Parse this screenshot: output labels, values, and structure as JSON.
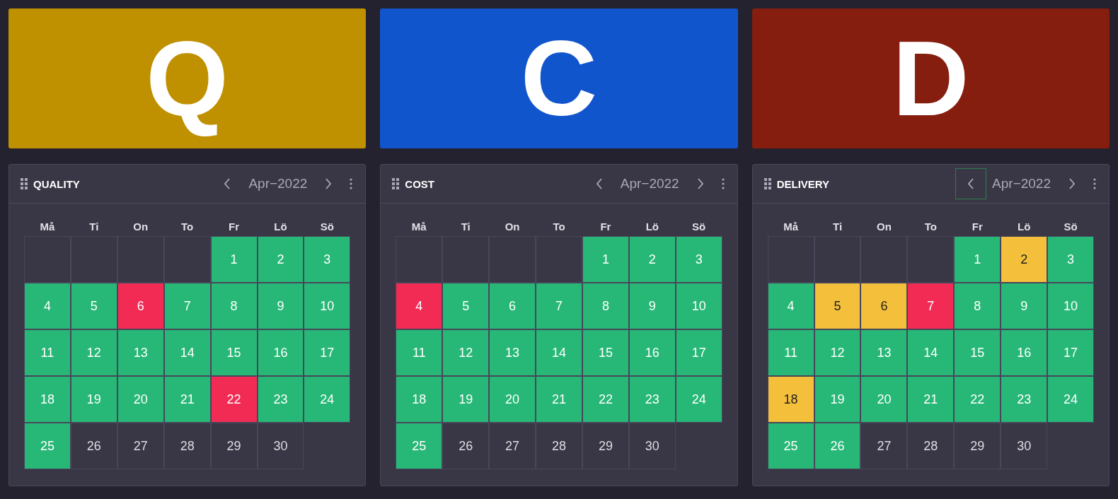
{
  "tiles": [
    {
      "letter": "Q",
      "color": "#bf9000"
    },
    {
      "letter": "C",
      "color": "#1155cc"
    },
    {
      "letter": "D",
      "color": "#851e0e"
    }
  ],
  "panels": [
    {
      "title": "QUALITY",
      "month": "Apr−2022",
      "prev_focused": false,
      "weekdays": [
        "Må",
        "Ti",
        "On",
        "To",
        "Fr",
        "Lö",
        "Sö"
      ],
      "days": [
        {
          "day": "1",
          "color": "#27b877"
        },
        {
          "day": "2",
          "color": "#27b877"
        },
        {
          "day": "3",
          "color": "#27b877"
        },
        {
          "day": "4",
          "color": "#27b877"
        },
        {
          "day": "5",
          "color": "#27b877"
        },
        {
          "day": "6",
          "color": "#f22b55"
        },
        {
          "day": "7",
          "color": "#27b877"
        },
        {
          "day": "8",
          "color": "#27b877"
        },
        {
          "day": "9",
          "color": "#27b877"
        },
        {
          "day": "10",
          "color": "#27b877"
        },
        {
          "day": "11",
          "color": "#27b877"
        },
        {
          "day": "12",
          "color": "#27b877"
        },
        {
          "day": "13",
          "color": "#27b877"
        },
        {
          "day": "14",
          "color": "#27b877"
        },
        {
          "day": "15",
          "color": "#27b877"
        },
        {
          "day": "16",
          "color": "#27b877"
        },
        {
          "day": "17",
          "color": "#27b877"
        },
        {
          "day": "18",
          "color": "#27b877"
        },
        {
          "day": "19",
          "color": "#27b877"
        },
        {
          "day": "20",
          "color": "#27b877"
        },
        {
          "day": "21",
          "color": "#27b877"
        },
        {
          "day": "22",
          "color": "#f22b55"
        },
        {
          "day": "23",
          "color": "#27b877"
        },
        {
          "day": "24",
          "color": "#27b877"
        },
        {
          "day": "25",
          "color": "#27b877"
        },
        {
          "day": "26",
          "color": "#393745"
        },
        {
          "day": "27",
          "color": "#393745"
        },
        {
          "day": "28",
          "color": "#393745"
        },
        {
          "day": "29",
          "color": "#393745"
        },
        {
          "day": "30",
          "color": "#393745"
        }
      ]
    },
    {
      "title": "COST",
      "month": "Apr−2022",
      "prev_focused": false,
      "weekdays": [
        "Må",
        "Ti",
        "On",
        "To",
        "Fr",
        "Lö",
        "Sö"
      ],
      "days": [
        {
          "day": "1",
          "color": "#27b877"
        },
        {
          "day": "2",
          "color": "#27b877"
        },
        {
          "day": "3",
          "color": "#27b877"
        },
        {
          "day": "4",
          "color": "#f22b55"
        },
        {
          "day": "5",
          "color": "#27b877"
        },
        {
          "day": "6",
          "color": "#27b877"
        },
        {
          "day": "7",
          "color": "#27b877"
        },
        {
          "day": "8",
          "color": "#27b877"
        },
        {
          "day": "9",
          "color": "#27b877"
        },
        {
          "day": "10",
          "color": "#27b877"
        },
        {
          "day": "11",
          "color": "#27b877"
        },
        {
          "day": "12",
          "color": "#27b877"
        },
        {
          "day": "13",
          "color": "#27b877"
        },
        {
          "day": "14",
          "color": "#27b877"
        },
        {
          "day": "15",
          "color": "#27b877"
        },
        {
          "day": "16",
          "color": "#27b877"
        },
        {
          "day": "17",
          "color": "#27b877"
        },
        {
          "day": "18",
          "color": "#27b877"
        },
        {
          "day": "19",
          "color": "#27b877"
        },
        {
          "day": "20",
          "color": "#27b877"
        },
        {
          "day": "21",
          "color": "#27b877"
        },
        {
          "day": "22",
          "color": "#27b877"
        },
        {
          "day": "23",
          "color": "#27b877"
        },
        {
          "day": "24",
          "color": "#27b877"
        },
        {
          "day": "25",
          "color": "#27b877"
        },
        {
          "day": "26",
          "color": "#393745"
        },
        {
          "day": "27",
          "color": "#393745"
        },
        {
          "day": "28",
          "color": "#393745"
        },
        {
          "day": "29",
          "color": "#393745"
        },
        {
          "day": "30",
          "color": "#393745"
        }
      ]
    },
    {
      "title": "DELIVERY",
      "month": "Apr−2022",
      "prev_focused": true,
      "weekdays": [
        "Må",
        "Ti",
        "On",
        "To",
        "Fr",
        "Lö",
        "Sö"
      ],
      "days": [
        {
          "day": "1",
          "color": "#27b877"
        },
        {
          "day": "2",
          "color": "#f4bf3a"
        },
        {
          "day": "3",
          "color": "#27b877"
        },
        {
          "day": "4",
          "color": "#27b877"
        },
        {
          "day": "5",
          "color": "#f4bf3a"
        },
        {
          "day": "6",
          "color": "#f4bf3a"
        },
        {
          "day": "7",
          "color": "#f22b55"
        },
        {
          "day": "8",
          "color": "#27b877"
        },
        {
          "day": "9",
          "color": "#27b877"
        },
        {
          "day": "10",
          "color": "#27b877"
        },
        {
          "day": "11",
          "color": "#27b877"
        },
        {
          "day": "12",
          "color": "#27b877"
        },
        {
          "day": "13",
          "color": "#27b877"
        },
        {
          "day": "14",
          "color": "#27b877"
        },
        {
          "day": "15",
          "color": "#27b877"
        },
        {
          "day": "16",
          "color": "#27b877"
        },
        {
          "day": "17",
          "color": "#27b877"
        },
        {
          "day": "18",
          "color": "#f4bf3a"
        },
        {
          "day": "19",
          "color": "#27b877"
        },
        {
          "day": "20",
          "color": "#27b877"
        },
        {
          "day": "21",
          "color": "#27b877"
        },
        {
          "day": "22",
          "color": "#27b877"
        },
        {
          "day": "23",
          "color": "#27b877"
        },
        {
          "day": "24",
          "color": "#27b877"
        },
        {
          "day": "25",
          "color": "#27b877"
        },
        {
          "day": "26",
          "color": "#27b877"
        },
        {
          "day": "27",
          "color": "#393745"
        },
        {
          "day": "28",
          "color": "#393745"
        },
        {
          "day": "29",
          "color": "#393745"
        },
        {
          "day": "30",
          "color": "#393745"
        }
      ]
    }
  ]
}
